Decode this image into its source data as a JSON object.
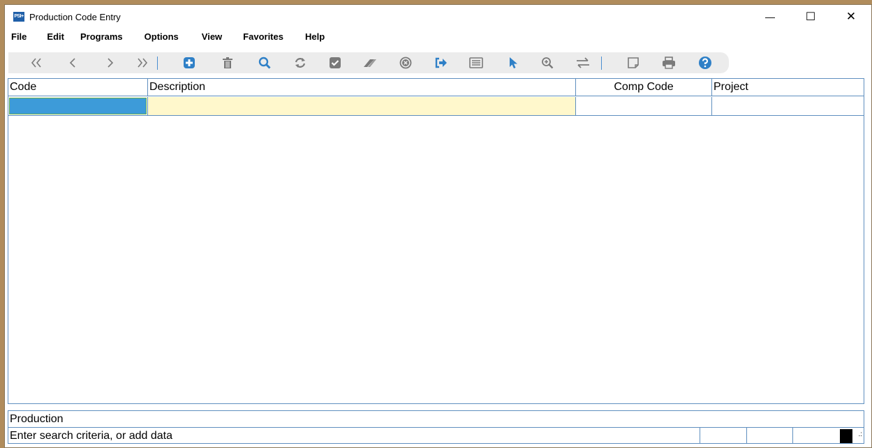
{
  "window": {
    "title": "Production Code Entry",
    "icon_text": "PSI+"
  },
  "controls": {
    "minimize": "—",
    "maximize": "☐",
    "close": "✕"
  },
  "menu": [
    "File",
    "Edit",
    "Programs",
    "Options",
    "View",
    "Favorites",
    "Help"
  ],
  "toolbar_icons": [
    "first-record-icon",
    "previous-record-icon",
    "next-record-icon",
    "last-record-icon",
    "add-icon",
    "delete-icon",
    "search-icon",
    "refresh-icon",
    "accept-icon",
    "clear-icon",
    "cancel-icon",
    "exit-icon",
    "list-icon",
    "pointer-icon",
    "zoom-icon",
    "swap-icon",
    "note-icon",
    "print-icon",
    "help-icon"
  ],
  "grid": {
    "columns": [
      "Code",
      "Description",
      "Comp Code",
      "Project"
    ],
    "rows": [
      [
        "",
        "",
        "",
        ""
      ]
    ]
  },
  "status": {
    "label": "Production",
    "message": "Enter search criteria, or add data"
  },
  "colors": {
    "accent": "#3d8fd1",
    "selected_cell": "#3d9bd9",
    "editing_cell": "#fff8cc",
    "border": "#5f8fbf",
    "frame": "#b08c5c",
    "toolbar_bg": "#ececec"
  }
}
